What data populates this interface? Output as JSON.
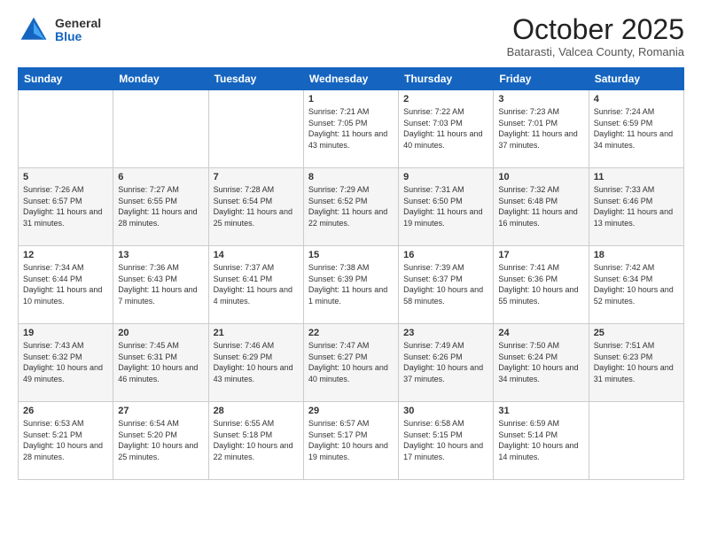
{
  "header": {
    "logo_general": "General",
    "logo_blue": "Blue",
    "month_title": "October 2025",
    "location": "Batarasti, Valcea County, Romania"
  },
  "weekdays": [
    "Sunday",
    "Monday",
    "Tuesday",
    "Wednesday",
    "Thursday",
    "Friday",
    "Saturday"
  ],
  "weeks": [
    [
      {
        "day": "",
        "sunrise": "",
        "sunset": "",
        "daylight": ""
      },
      {
        "day": "",
        "sunrise": "",
        "sunset": "",
        "daylight": ""
      },
      {
        "day": "",
        "sunrise": "",
        "sunset": "",
        "daylight": ""
      },
      {
        "day": "1",
        "sunrise": "Sunrise: 7:21 AM",
        "sunset": "Sunset: 7:05 PM",
        "daylight": "Daylight: 11 hours and 43 minutes."
      },
      {
        "day": "2",
        "sunrise": "Sunrise: 7:22 AM",
        "sunset": "Sunset: 7:03 PM",
        "daylight": "Daylight: 11 hours and 40 minutes."
      },
      {
        "day": "3",
        "sunrise": "Sunrise: 7:23 AM",
        "sunset": "Sunset: 7:01 PM",
        "daylight": "Daylight: 11 hours and 37 minutes."
      },
      {
        "day": "4",
        "sunrise": "Sunrise: 7:24 AM",
        "sunset": "Sunset: 6:59 PM",
        "daylight": "Daylight: 11 hours and 34 minutes."
      }
    ],
    [
      {
        "day": "5",
        "sunrise": "Sunrise: 7:26 AM",
        "sunset": "Sunset: 6:57 PM",
        "daylight": "Daylight: 11 hours and 31 minutes."
      },
      {
        "day": "6",
        "sunrise": "Sunrise: 7:27 AM",
        "sunset": "Sunset: 6:55 PM",
        "daylight": "Daylight: 11 hours and 28 minutes."
      },
      {
        "day": "7",
        "sunrise": "Sunrise: 7:28 AM",
        "sunset": "Sunset: 6:54 PM",
        "daylight": "Daylight: 11 hours and 25 minutes."
      },
      {
        "day": "8",
        "sunrise": "Sunrise: 7:29 AM",
        "sunset": "Sunset: 6:52 PM",
        "daylight": "Daylight: 11 hours and 22 minutes."
      },
      {
        "day": "9",
        "sunrise": "Sunrise: 7:31 AM",
        "sunset": "Sunset: 6:50 PM",
        "daylight": "Daylight: 11 hours and 19 minutes."
      },
      {
        "day": "10",
        "sunrise": "Sunrise: 7:32 AM",
        "sunset": "Sunset: 6:48 PM",
        "daylight": "Daylight: 11 hours and 16 minutes."
      },
      {
        "day": "11",
        "sunrise": "Sunrise: 7:33 AM",
        "sunset": "Sunset: 6:46 PM",
        "daylight": "Daylight: 11 hours and 13 minutes."
      }
    ],
    [
      {
        "day": "12",
        "sunrise": "Sunrise: 7:34 AM",
        "sunset": "Sunset: 6:44 PM",
        "daylight": "Daylight: 11 hours and 10 minutes."
      },
      {
        "day": "13",
        "sunrise": "Sunrise: 7:36 AM",
        "sunset": "Sunset: 6:43 PM",
        "daylight": "Daylight: 11 hours and 7 minutes."
      },
      {
        "day": "14",
        "sunrise": "Sunrise: 7:37 AM",
        "sunset": "Sunset: 6:41 PM",
        "daylight": "Daylight: 11 hours and 4 minutes."
      },
      {
        "day": "15",
        "sunrise": "Sunrise: 7:38 AM",
        "sunset": "Sunset: 6:39 PM",
        "daylight": "Daylight: 11 hours and 1 minute."
      },
      {
        "day": "16",
        "sunrise": "Sunrise: 7:39 AM",
        "sunset": "Sunset: 6:37 PM",
        "daylight": "Daylight: 10 hours and 58 minutes."
      },
      {
        "day": "17",
        "sunrise": "Sunrise: 7:41 AM",
        "sunset": "Sunset: 6:36 PM",
        "daylight": "Daylight: 10 hours and 55 minutes."
      },
      {
        "day": "18",
        "sunrise": "Sunrise: 7:42 AM",
        "sunset": "Sunset: 6:34 PM",
        "daylight": "Daylight: 10 hours and 52 minutes."
      }
    ],
    [
      {
        "day": "19",
        "sunrise": "Sunrise: 7:43 AM",
        "sunset": "Sunset: 6:32 PM",
        "daylight": "Daylight: 10 hours and 49 minutes."
      },
      {
        "day": "20",
        "sunrise": "Sunrise: 7:45 AM",
        "sunset": "Sunset: 6:31 PM",
        "daylight": "Daylight: 10 hours and 46 minutes."
      },
      {
        "day": "21",
        "sunrise": "Sunrise: 7:46 AM",
        "sunset": "Sunset: 6:29 PM",
        "daylight": "Daylight: 10 hours and 43 minutes."
      },
      {
        "day": "22",
        "sunrise": "Sunrise: 7:47 AM",
        "sunset": "Sunset: 6:27 PM",
        "daylight": "Daylight: 10 hours and 40 minutes."
      },
      {
        "day": "23",
        "sunrise": "Sunrise: 7:49 AM",
        "sunset": "Sunset: 6:26 PM",
        "daylight": "Daylight: 10 hours and 37 minutes."
      },
      {
        "day": "24",
        "sunrise": "Sunrise: 7:50 AM",
        "sunset": "Sunset: 6:24 PM",
        "daylight": "Daylight: 10 hours and 34 minutes."
      },
      {
        "day": "25",
        "sunrise": "Sunrise: 7:51 AM",
        "sunset": "Sunset: 6:23 PM",
        "daylight": "Daylight: 10 hours and 31 minutes."
      }
    ],
    [
      {
        "day": "26",
        "sunrise": "Sunrise: 6:53 AM",
        "sunset": "Sunset: 5:21 PM",
        "daylight": "Daylight: 10 hours and 28 minutes."
      },
      {
        "day": "27",
        "sunrise": "Sunrise: 6:54 AM",
        "sunset": "Sunset: 5:20 PM",
        "daylight": "Daylight: 10 hours and 25 minutes."
      },
      {
        "day": "28",
        "sunrise": "Sunrise: 6:55 AM",
        "sunset": "Sunset: 5:18 PM",
        "daylight": "Daylight: 10 hours and 22 minutes."
      },
      {
        "day": "29",
        "sunrise": "Sunrise: 6:57 AM",
        "sunset": "Sunset: 5:17 PM",
        "daylight": "Daylight: 10 hours and 19 minutes."
      },
      {
        "day": "30",
        "sunrise": "Sunrise: 6:58 AM",
        "sunset": "Sunset: 5:15 PM",
        "daylight": "Daylight: 10 hours and 17 minutes."
      },
      {
        "day": "31",
        "sunrise": "Sunrise: 6:59 AM",
        "sunset": "Sunset: 5:14 PM",
        "daylight": "Daylight: 10 hours and 14 minutes."
      },
      {
        "day": "",
        "sunrise": "",
        "sunset": "",
        "daylight": ""
      }
    ]
  ]
}
